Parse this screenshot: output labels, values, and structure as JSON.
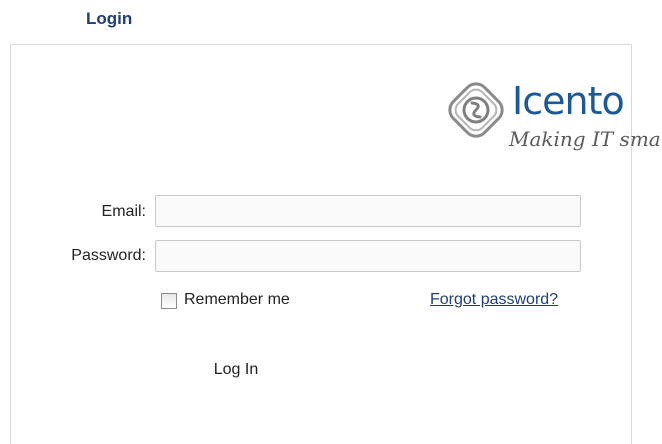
{
  "page": {
    "heading": "Login"
  },
  "logo": {
    "name": "Icento",
    "tagline": "Making IT smart",
    "brand_color": "#1a5a9a",
    "mark_icon": "icento-swirl-logo-icon"
  },
  "form": {
    "email_label": "Email:",
    "email_value": "",
    "password_label": "Password:",
    "password_value": "",
    "remember_label": "Remember me",
    "remember_checked": false,
    "forgot_label": "Forgot password?",
    "submit_label": "Log In"
  },
  "colors": {
    "heading": "#1f3f74",
    "link": "#1f3f74",
    "border": "#d9d9d9"
  }
}
